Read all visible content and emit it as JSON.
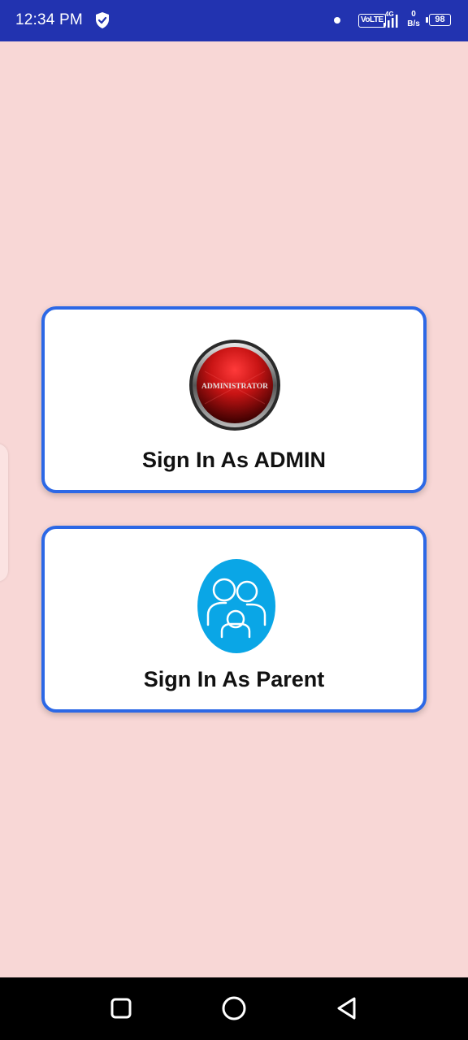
{
  "status_bar": {
    "time": "12:34 PM",
    "volte_label": "VoLTE",
    "network_type": "4G",
    "net_speed_value": "0",
    "net_speed_unit": "B/s",
    "battery_level": "98",
    "icons": [
      "shield-check-icon",
      "notification-dot-icon",
      "signal-icon",
      "battery-icon"
    ]
  },
  "cards": {
    "admin": {
      "label": "Sign In As ADMIN",
      "icon_text": "ADMINISTRATOR",
      "icon": "administrator-button-icon"
    },
    "parent": {
      "label": "Sign In As Parent",
      "icon": "family-icon"
    }
  },
  "nav_bar": {
    "icons": [
      "recent-apps-icon",
      "home-icon",
      "back-icon"
    ]
  },
  "colors": {
    "background": "#f8d7d6",
    "status_bar": "#2233b0",
    "card_border": "#2c68e6",
    "admin_red": "#c81414",
    "parent_blue": "#0aa6e6"
  }
}
